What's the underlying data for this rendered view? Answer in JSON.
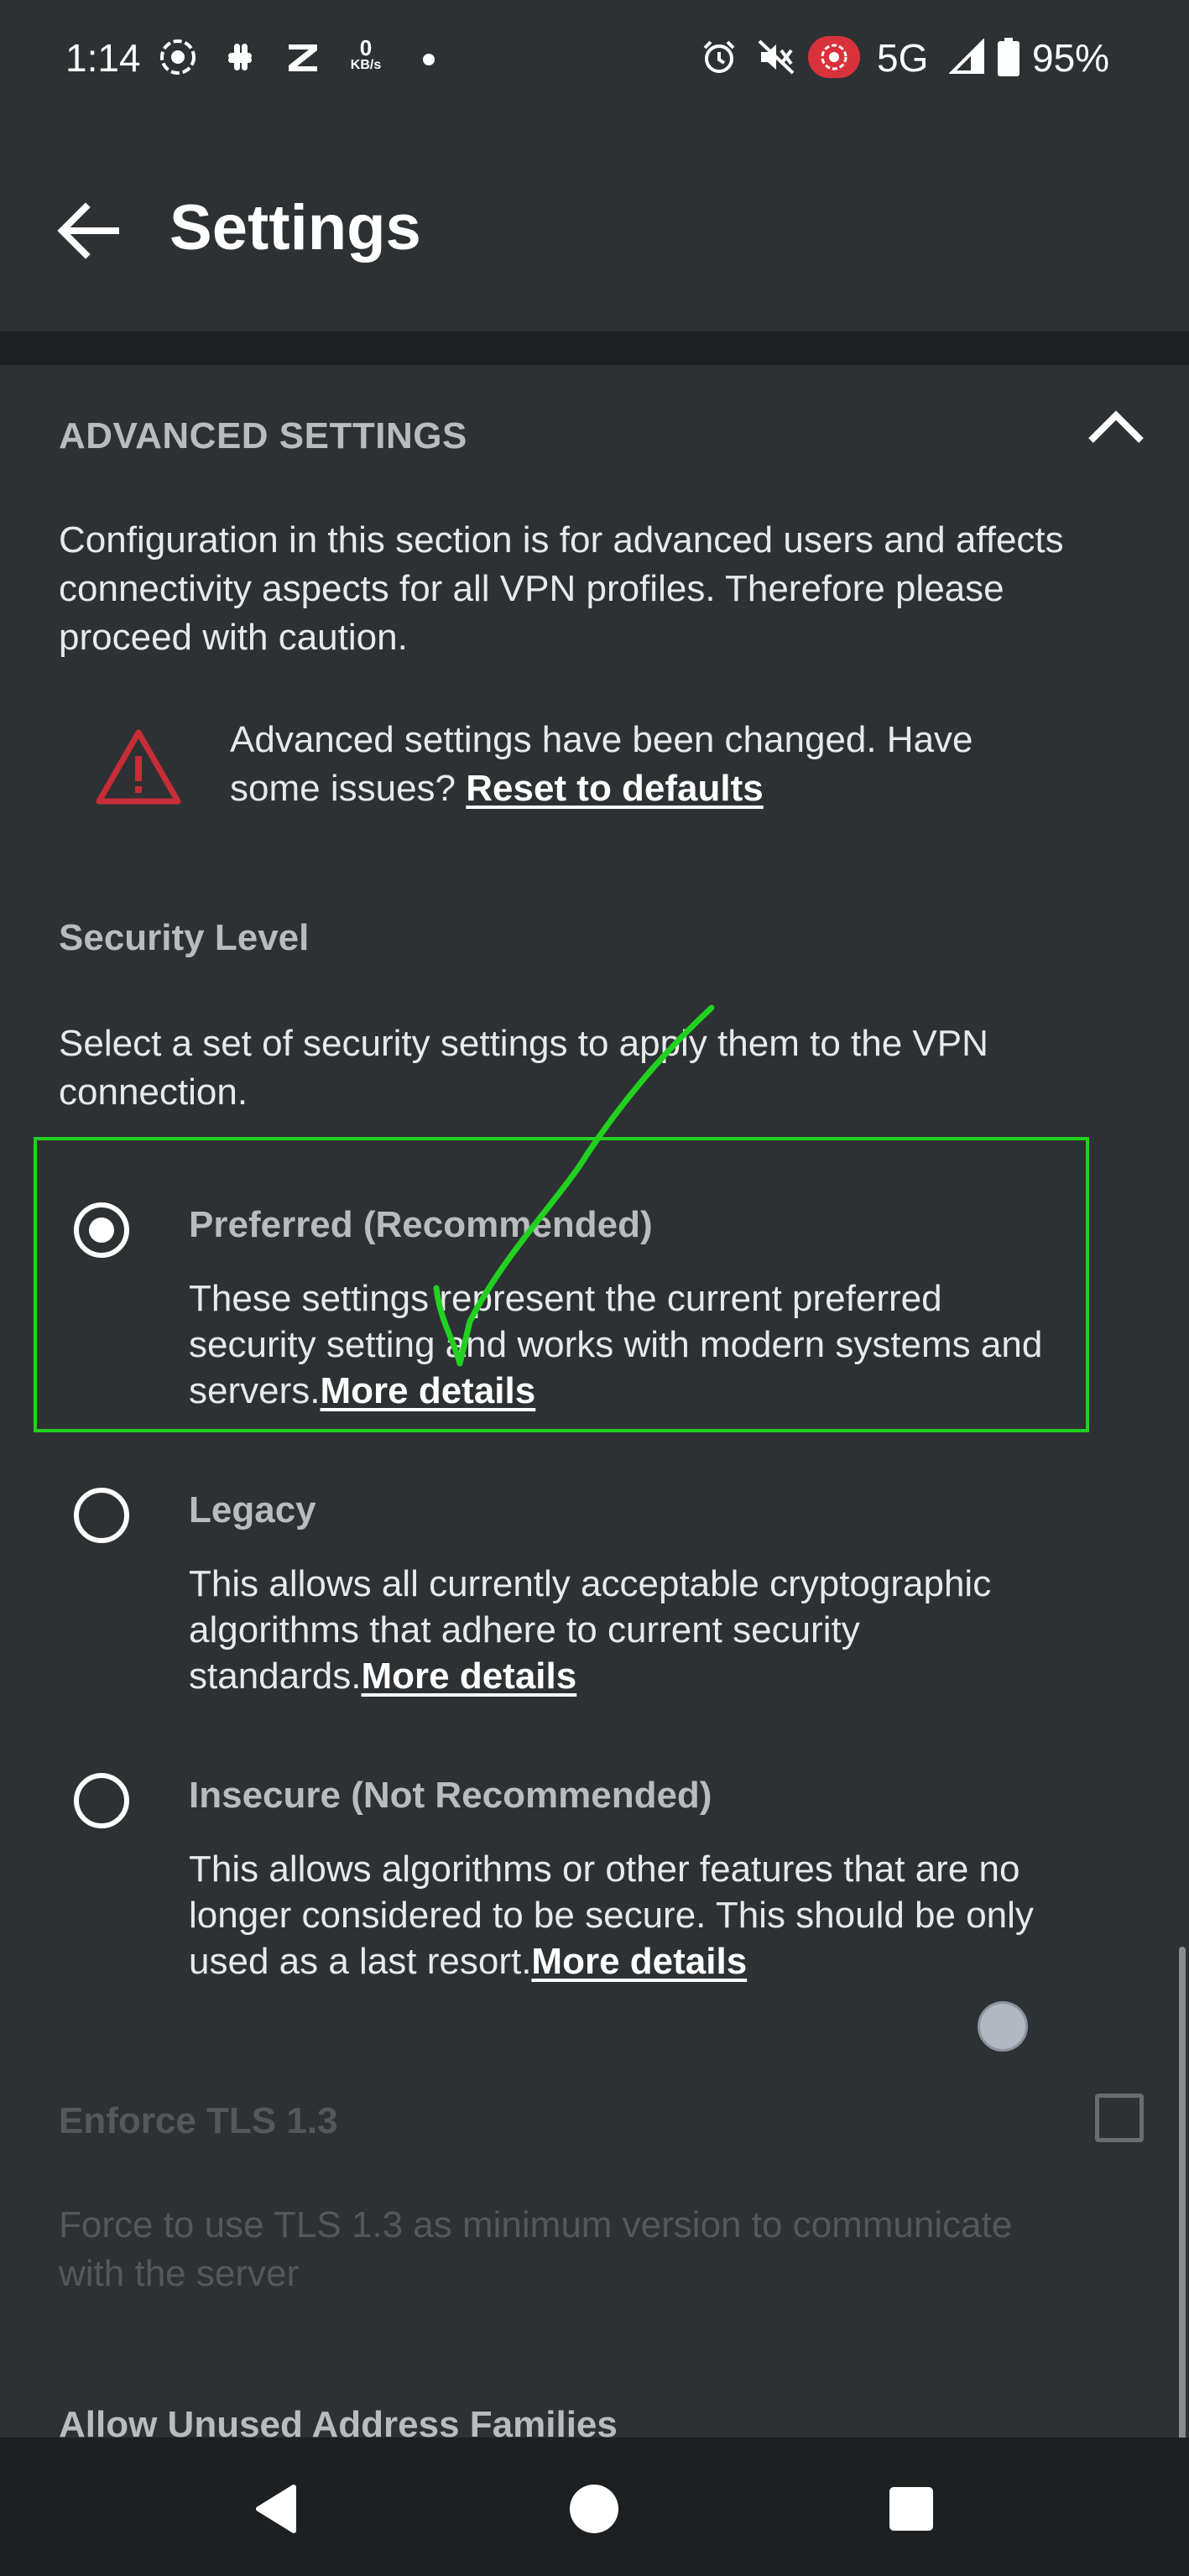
{
  "status_bar": {
    "time": "1:14",
    "network_speed_value": "0",
    "network_speed_unit": "KB/s",
    "network": "5G",
    "battery": "95%",
    "icons": [
      "screen-record-icon",
      "slack-icon",
      "z-app-icon",
      "alarm-icon",
      "mute-icon",
      "recording-indicator-icon",
      "signal-icon",
      "battery-icon"
    ]
  },
  "app_bar": {
    "title": "Settings",
    "back_icon": "arrow-left-icon"
  },
  "advanced": {
    "section_title": "ADVANCED SETTINGS",
    "collapse_icon": "chevron-up-icon",
    "description": "Configuration in this section is for advanced users and affects connectivity aspects for all VPN profiles. Therefore please proceed with caution.",
    "warning_text": "Advanced settings have been changed. Have some issues? ",
    "warning_link": "Reset to defaults",
    "warning_icon": "warning-triangle-icon"
  },
  "security": {
    "title": "Security Level",
    "description": "Select a set of security settings to apply them to the VPN connection.",
    "options": [
      {
        "label": "Preferred (Recommended)",
        "description": "These settings represent the current preferred security setting and works with modern systems and servers.",
        "link": "More details",
        "selected": true
      },
      {
        "label": "Legacy",
        "description": "This allows all currently acceptable cryptographic algorithms that adhere to current security standards.",
        "link": "More details",
        "selected": false
      },
      {
        "label": "Insecure (Not Recommended)",
        "description": "This allows algorithms or other features that are no longer considered to be secure. This should be only used as a last resort.",
        "link": "More details",
        "selected": false
      }
    ]
  },
  "tls": {
    "title": "Enforce TLS 1.3",
    "description": "Force to use TLS 1.3 as minimum version  to communicate with the server",
    "checked": false
  },
  "next_section": {
    "title": "Allow Unused Address Families"
  },
  "colors": {
    "background": "#2e3134",
    "annotation_green": "#21d11f",
    "warning_red": "#c62d36"
  }
}
